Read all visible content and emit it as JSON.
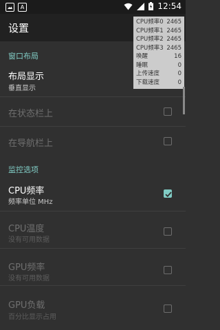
{
  "status_bar": {
    "time": "12:54",
    "notifications": [
      {
        "icon": "image-notification-icon"
      },
      {
        "icon": "font-a-notification-icon"
      }
    ],
    "status_icons": [
      "wifi-icon",
      "signal-icon",
      "battery-charging-icon"
    ]
  },
  "app_bar": {
    "title": "设置"
  },
  "overlay": {
    "rows": [
      {
        "label": "CPU频率0",
        "value": "2465"
      },
      {
        "label": "CPU频率1",
        "value": "2465"
      },
      {
        "label": "CPU频率2",
        "value": "2465"
      },
      {
        "label": "CPU频率3",
        "value": "2465"
      },
      {
        "label": "唤醒",
        "value": "16"
      },
      {
        "label": "睡眠",
        "value": "0"
      },
      {
        "label": "上传速度",
        "value": "0"
      },
      {
        "label": "下载速度",
        "value": "0"
      }
    ]
  },
  "sections": {
    "window_layout": {
      "header": "窗口布局",
      "layout_display": {
        "title": "布局显示",
        "summary": "垂直显示"
      },
      "on_status_bar": {
        "title": "在状态栏上",
        "checked": false,
        "enabled": false
      },
      "on_nav_bar": {
        "title": "在导航栏上",
        "checked": false,
        "enabled": false
      }
    },
    "monitor": {
      "header": "监控选项",
      "cpu_freq": {
        "title": "CPU频率",
        "summary": "频率单位 MHz",
        "checked": true,
        "enabled": true
      },
      "cpu_temp": {
        "title": "CPU温度",
        "summary": "没有可用数据",
        "checked": false,
        "enabled": false
      },
      "gpu_freq": {
        "title": "GPU频率",
        "summary": "没有可用数据",
        "checked": false,
        "enabled": false
      },
      "gpu_load": {
        "title": "GPU负载",
        "summary": "百分比显示占用",
        "checked": false,
        "enabled": false
      }
    }
  },
  "colors": {
    "accent": "#80cbc4",
    "background": "#303030",
    "app_bar": "#212121"
  }
}
